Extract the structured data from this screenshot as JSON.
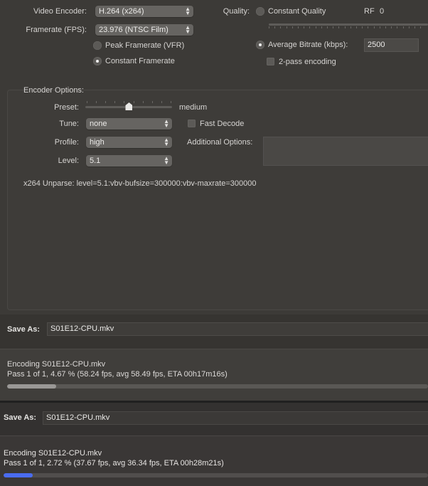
{
  "video": {
    "encoder_label": "Video Encoder:",
    "encoder_value": "H.264 (x264)",
    "framerate_label": "Framerate (FPS):",
    "framerate_value": "23.976 (NTSC Film)",
    "peak_framerate": "Peak Framerate (VFR)",
    "constant_framerate": "Constant Framerate",
    "selected_framerate_mode": "constant"
  },
  "quality": {
    "label": "Quality:",
    "constant_quality": "Constant Quality",
    "rf_label": "RF",
    "rf_value": "0",
    "average_bitrate": "Average Bitrate (kbps):",
    "bitrate_value": "2500",
    "two_pass": "2-pass encoding",
    "two_pass_checked": false,
    "selected_mode": "average_bitrate"
  },
  "encoder_options": {
    "title": "Encoder Options:",
    "preset_label": "Preset:",
    "preset_value": "medium",
    "preset_position": 0.5,
    "tune_label": "Tune:",
    "tune_value": "none",
    "fast_decode": "Fast Decode",
    "fast_decode_checked": false,
    "profile_label": "Profile:",
    "profile_value": "high",
    "additional_label": "Additional Options:",
    "additional_value": "",
    "level_label": "Level:",
    "level_value": "5.1",
    "unparse": "x264 Unparse: level=5.1:vbv-bufsize=300000:vbv-maxrate=300000"
  },
  "job1": {
    "save_as_label": "Save As:",
    "filename": "S01E12-CPU.mkv",
    "status_line": "Encoding S01E12-CPU.mkv",
    "progress_line": "Pass 1 of 1, 4.67 % (58.24 fps, avg 58.49 fps, ETA 00h17m16s)",
    "progress_percent": 4.67,
    "bar_color": "#9a9896"
  },
  "job2": {
    "save_as_label": "Save As:",
    "filename": "S01E12-CPU.mkv",
    "status_line": "Encoding S01E12-CPU.mkv",
    "progress_line": "Pass 1 of 1, 2.72 % (37.67 fps, avg 36.34 fps, ETA 00h28m21s)",
    "progress_percent": 2.72,
    "bar_color": "#4a6cf0"
  }
}
